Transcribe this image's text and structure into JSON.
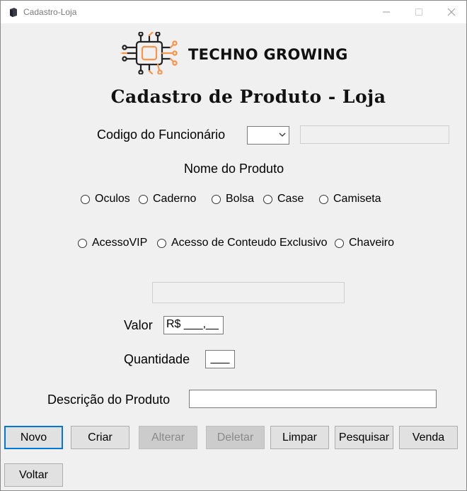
{
  "window": {
    "title": "Cadastro-Loja"
  },
  "logo": {
    "text": "TECHNO GROWING",
    "accent": "#f7954a"
  },
  "form": {
    "title": "Cadastro de Produto - Loja",
    "employee_code_label": "Codigo do Funcionário",
    "product_name_label": "Nome  do Produto",
    "value_label": "Valor",
    "value_mask": "R$ ___,__",
    "quantity_label": "Quantidade",
    "quantity_mask": "___",
    "description_label": "Descrição do Produto"
  },
  "products_row1": [
    "Oculos",
    "Caderno",
    "Bolsa",
    "Case",
    "Camiseta"
  ],
  "products_row2": [
    "AcessoVIP",
    "Acesso de Conteudo Exclusivo",
    "Chaveiro"
  ],
  "buttons": {
    "novo": "Novo",
    "criar": "Criar",
    "alterar": "Alterar",
    "deletar": "Deletar",
    "limpar": "Limpar",
    "pesquisar": "Pesquisar",
    "venda": "Venda",
    "voltar": "Voltar"
  },
  "colors": {
    "focus_border": "#0078d7",
    "disabled_button": "#cccccc"
  }
}
